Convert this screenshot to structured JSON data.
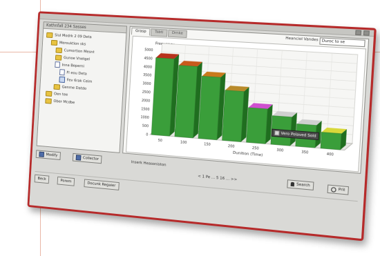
{
  "window": {
    "header_left": "Kathnfall 234 Sasses"
  },
  "tree": {
    "items": [
      {
        "label": "Siul Modrk 2 09 Deta",
        "icon": "folder-icon"
      },
      {
        "label": "Merouktion sks",
        "icon": "folder-icon"
      },
      {
        "label": "Cumortion Mesnt",
        "icon": "folder-icon"
      },
      {
        "label": "Gunoe Vnetgel",
        "icon": "folder-icon"
      },
      {
        "label": "Inna Beperni",
        "icon": "doc-icon"
      },
      {
        "label": "Fl eou Deta",
        "icon": "doc-icon"
      },
      {
        "label": "Fev 6rak Ceim",
        "icon": "table-icon"
      },
      {
        "label": "Genme Datdo",
        "icon": "folder-icon"
      },
      {
        "label": "Oen tee",
        "icon": "folder-icon"
      },
      {
        "label": "Ober Mcdbe",
        "icon": "folder-icon"
      }
    ]
  },
  "tabs": [
    "Grasp",
    "Tsbti",
    "Drnke"
  ],
  "selector": {
    "label": "Heanciol Vandes",
    "value": "Duroc to se"
  },
  "chart_data": {
    "type": "bar",
    "title": "Frequency",
    "xlabel": "Dunition (Time)",
    "ylabel": "",
    "categories": [
      "50",
      "100",
      "150",
      "200",
      "250",
      "300",
      "350",
      "400"
    ],
    "values": [
      50,
      46,
      40,
      32,
      22,
      18,
      14,
      10
    ],
    "y_tick_labels": [
      "5000",
      "4500",
      "4000",
      "3500",
      "3000",
      "2500",
      "2000",
      "1500",
      "1000",
      "500",
      "0"
    ],
    "ylim": [
      0,
      55
    ],
    "grid": true,
    "colors": {
      "bar": "#3a9e3a",
      "bar_side": "#1f6e1f",
      "caps": [
        "#b8321c",
        "#c85a1c",
        "#c87a1c",
        "#b88a2a",
        "#cf4fcf",
        "#d0d0d0",
        "#d0d0d0",
        "#d8d83a"
      ]
    },
    "tooltip": "Vero Polaved Sold"
  },
  "bottom": {
    "btn_modify": "Modify",
    "btn_selector": "Collector",
    "status": "Inserk Heasoniston",
    "pager": "<  1  Pe  ...  5  16  ...  >>",
    "btn_search": "Search",
    "btn_print": "Prit"
  },
  "footer": {
    "btn_back": "Beck",
    "btn_forward": "Porem",
    "btn_report": "Docunk Regaier"
  }
}
